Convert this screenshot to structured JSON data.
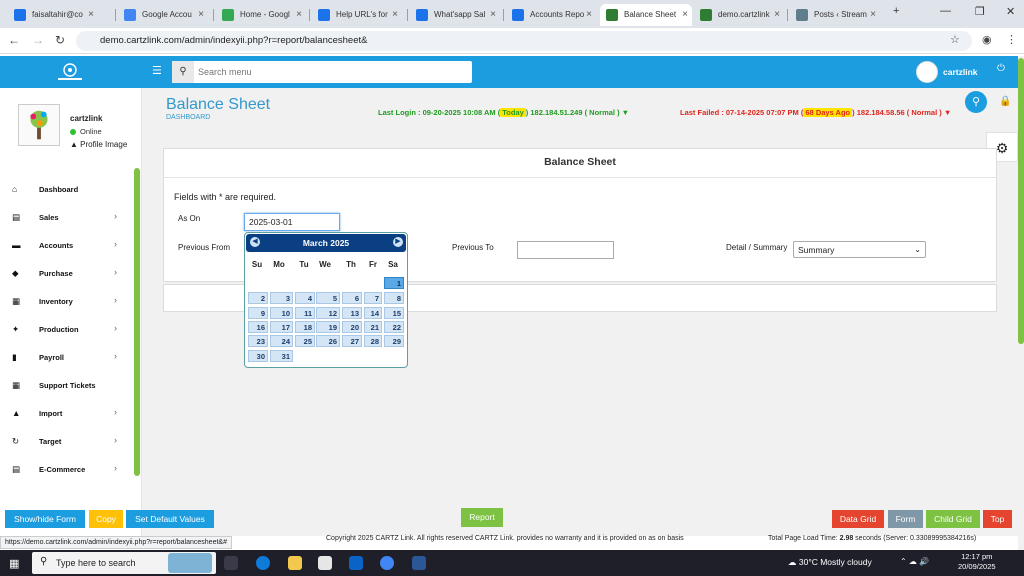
{
  "browser": {
    "tabs": [
      {
        "label": "faisaltahir@co",
        "color": "#1a73e8"
      },
      {
        "label": "Google Accou",
        "color": "#4285f4"
      },
      {
        "label": "Home - Googl",
        "color": "#34a853"
      },
      {
        "label": "Help URL's for",
        "color": "#1a73e8"
      },
      {
        "label": "What'sapp Sal",
        "color": "#1a73e8"
      },
      {
        "label": "Accounts Repo",
        "color": "#1a73e8"
      },
      {
        "label": "Balance Sheet",
        "color": "#2e7d32"
      },
      {
        "label": "demo.cartzlink",
        "color": "#2e7d32"
      },
      {
        "label": "Posts ‹ Stream",
        "color": "#607d8b"
      }
    ],
    "url": "demo.cartzlink.com/admin/indexyii.php?r=report/balancesheet&"
  },
  "header": {
    "search_placeholder": "Search menu",
    "user_name": "cartzlink"
  },
  "profile": {
    "name": "cartzlink",
    "status": "Online",
    "image_link": "Profile Image"
  },
  "sidebar": {
    "items": [
      {
        "label": "Dashboard",
        "icon": "tachometer-icon",
        "glyph": "⌂",
        "chevron": false
      },
      {
        "label": "Sales",
        "icon": "cart-icon",
        "glyph": "▤",
        "chevron": true
      },
      {
        "label": "Accounts",
        "icon": "bank-icon",
        "glyph": "▬",
        "chevron": true
      },
      {
        "label": "Purchase",
        "icon": "tag-icon",
        "glyph": "◆",
        "chevron": true
      },
      {
        "label": "Inventory",
        "icon": "grid-icon",
        "glyph": "▦",
        "chevron": true
      },
      {
        "label": "Production",
        "icon": "cogs-icon",
        "glyph": "✦",
        "chevron": true
      },
      {
        "label": "Payroll",
        "icon": "money-icon",
        "glyph": "▮",
        "chevron": true
      },
      {
        "label": "Support Tickets",
        "icon": "ticket-icon",
        "glyph": "▦",
        "chevron": false
      },
      {
        "label": "Import",
        "icon": "upload-icon",
        "glyph": "▲",
        "chevron": true
      },
      {
        "label": "Target",
        "icon": "refresh-icon",
        "glyph": "↻",
        "chevron": true
      },
      {
        "label": "E-Commerce",
        "icon": "cart-icon",
        "glyph": "▤",
        "chevron": true
      }
    ]
  },
  "page": {
    "title": "Balance Sheet",
    "subtitle": "DASHBOARD",
    "last_login_prefix": "Last Login : 09-20-2025 10:08 AM (",
    "last_login_badge": "Today",
    "last_login_suffix": ") 182.184.51.249 ( Normal ) ▼",
    "last_failed_prefix": "Last Failed : 07-14-2025 07:07 PM (",
    "last_failed_badge": "68 Days Ago",
    "last_failed_suffix": ") 182.184.58.56 ( Normal ) ▼"
  },
  "form": {
    "heading": "Balance Sheet",
    "required_note": "Fields with * are required.",
    "as_on_label": "As On",
    "as_on_value": "2025-03-01",
    "previous_from_label": "Previous From",
    "previous_to_label": "Previous To",
    "detail_label": "Detail / Summary",
    "detail_value": "Summary"
  },
  "datepicker": {
    "month_label": "March 2025",
    "weekdays": [
      "Su",
      "Mo",
      "Tu",
      "We",
      "Th",
      "Fr",
      "Sa"
    ],
    "first_weekday_index": 6,
    "days_in_month": 31,
    "selected_day": 1
  },
  "footer": {
    "buttons_left": [
      {
        "label": "Show/hide Form",
        "color": "#1b9de0"
      },
      {
        "label": "Copy",
        "color": "#ffc107"
      },
      {
        "label": "Set Default Values",
        "color": "#1b9de0"
      }
    ],
    "report_button": {
      "label": "Report",
      "color": "#7dc242"
    },
    "buttons_right": [
      {
        "label": "Data Grid",
        "color": "#e5452f"
      },
      {
        "label": "Form",
        "color": "#7f97a6"
      },
      {
        "label": "Child Grid",
        "color": "#7dc242"
      },
      {
        "label": "Top",
        "color": "#e5452f"
      }
    ],
    "copyright": "Copyright 2025 CARTZ Link. All rights reserved CARTZ Link. provides no warranty and it is provided on as on basis",
    "load_prefix": "Total Page Load Time: ",
    "load_bold": "2.98",
    "load_suffix": " seconds (Server: 0.33089995384216s)",
    "status_url": "https://demo.cartzlink.com/admin/indexyii.php?r=report/balancesheet&#"
  },
  "taskbar": {
    "search_text": "Type here to search",
    "weather": "30°C  Mostly cloudy",
    "time": "12:17 pm",
    "date": "20/09/2025"
  }
}
